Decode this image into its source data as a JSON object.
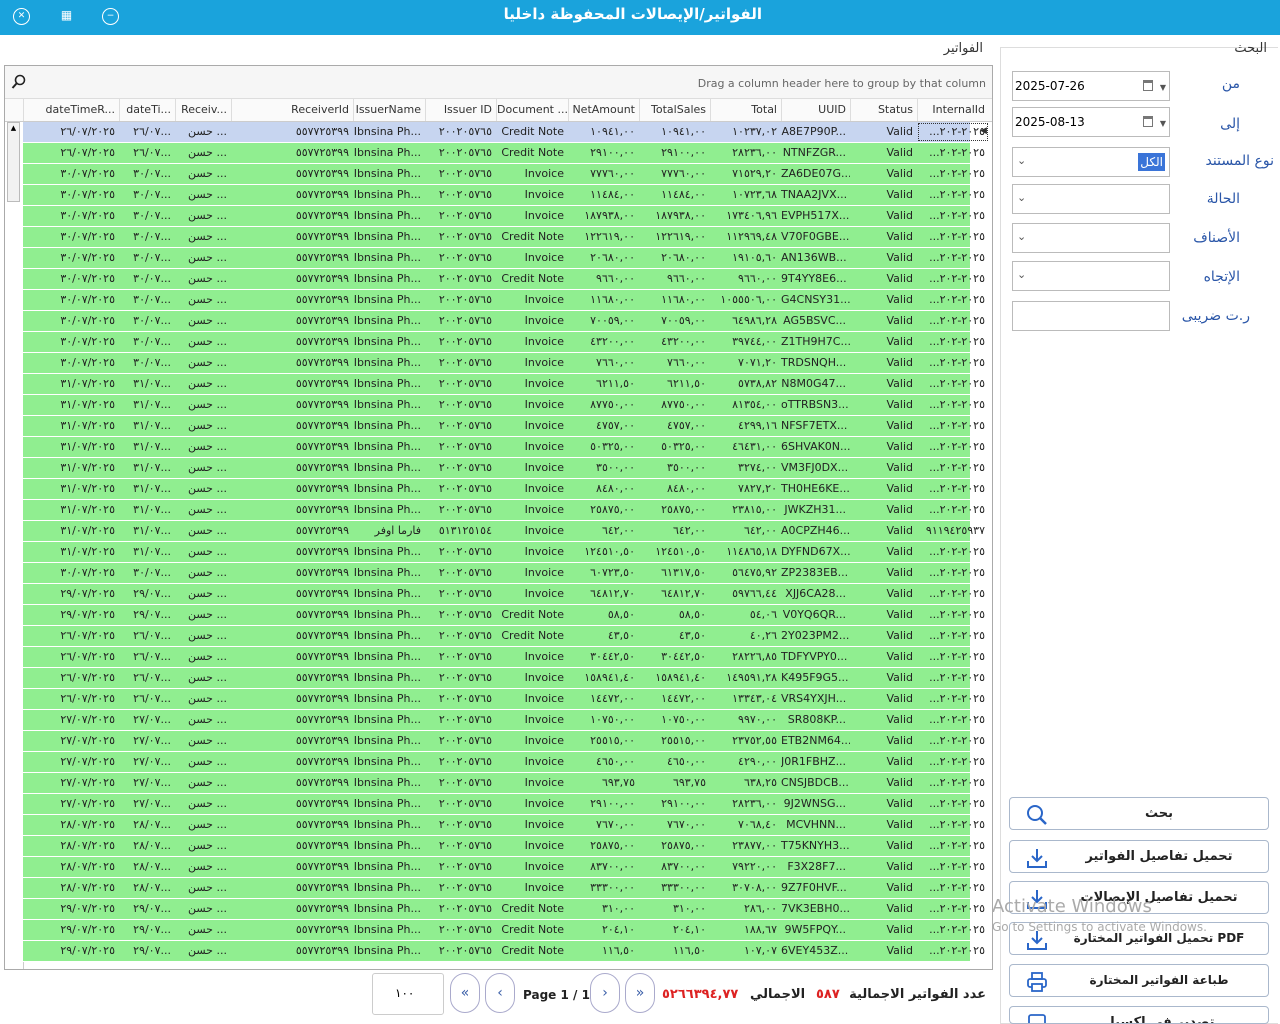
{
  "window": {
    "title": "الفواتير/الإيصالات المحفوظة داخليا",
    "buttons": [
      "close-icon",
      "maximize-icon",
      "minimize-icon"
    ]
  },
  "search": {
    "group_label": "البحث",
    "from_label": "من",
    "from_value": "2025-07-26",
    "to_label": "إلى",
    "to_value": "2025-08-13",
    "doctype_label": "نوع المستند",
    "doctype_value": "الكل",
    "status_label": "الحالة",
    "items_label": "الأصناف",
    "direction_label": "الإتجاه",
    "taxid_label": "ر.ت ضريبى"
  },
  "actions": {
    "search": "بحث",
    "load_invoices": "تحميل تفاصيل الفواتير",
    "load_receipts": "تحميل تفاصيل الإيصالات",
    "load_pdf": "تحميل الفواتير المختارة PDF",
    "print": "طباعة الفواتير المختارة",
    "export_excel": "تصدير في اكسيل"
  },
  "grid": {
    "title": "الفواتير",
    "group_hint": "Drag a column header here to group by that column",
    "columns": [
      "InternalId",
      "Status",
      "UUID",
      "Total",
      "TotalSales",
      "NetAmount",
      "Document ...",
      "Issuer ID",
      "IssuerName",
      "ReceiverId",
      "Receiv...",
      "dateTi...",
      "dateTimeR..."
    ],
    "rows": [
      [
        "...٢٠٢٥-٢٠٢",
        "Valid",
        "A8E7P90P...",
        "١٠٢٣٧,٠٢",
        "١٠٩٤١,٠٠",
        "١٠٩٤١,٠٠",
        "Credit Note",
        "٢٠٠٢٠٥٧٦٥",
        "Ibnsina Ph...",
        "٥٥٧٧٢٥٣٩٩",
        "حسن ...",
        "٢٦/٠٧...",
        "٢٦/٠٧/٢٠٢٥"
      ],
      [
        "...٢٠٢٥-٢٠٢",
        "Valid",
        "NTNFZGR...",
        "٢٨٢٣٦,٠٠",
        "٢٩١٠٠,٠٠",
        "٢٩١٠٠,٠٠",
        "Credit Note",
        "٢٠٠٢٠٥٧٦٥",
        "Ibnsina Ph...",
        "٥٥٧٧٢٥٣٩٩",
        "حسن ...",
        "٢٦/٠٧...",
        "٢٦/٠٧/٢٠٢٥"
      ],
      [
        "...٢٠٢٥-٢٠٢",
        "Valid",
        "ZA6DE07G...",
        "٧١٥٢٩,٢٠",
        "٧٧٧٦٠,٠٠",
        "٧٧٧٦٠,٠٠",
        "Invoice",
        "٢٠٠٢٠٥٧٦٥",
        "Ibnsina Ph...",
        "٥٥٧٧٢٥٣٩٩",
        "حسن ...",
        "٣٠/٠٧...",
        "٣٠/٠٧/٢٠٢٥"
      ],
      [
        "...٢٠٢٥-٢٠٢",
        "Valid",
        "TNAA2JVX...",
        "١٠٧٢٣,٦٨",
        "١١٤٨٤,٠٠",
        "١١٤٨٤,٠٠",
        "Invoice",
        "٢٠٠٢٠٥٧٦٥",
        "Ibnsina Ph...",
        "٥٥٧٧٢٥٣٩٩",
        "حسن ...",
        "٣٠/٠٧...",
        "٣٠/٠٧/٢٠٢٥"
      ],
      [
        "...٢٠٢٥-٢٠٢",
        "Valid",
        "EVPH517X...",
        "١٧٣٤٠٦,٩٦",
        "١٨٧٩٣٨,٠٠",
        "١٨٧٩٣٨,٠٠",
        "Invoice",
        "٢٠٠٢٠٥٧٦٥",
        "Ibnsina Ph...",
        "٥٥٧٧٢٥٣٩٩",
        "حسن ...",
        "٣٠/٠٧...",
        "٣٠/٠٧/٢٠٢٥"
      ],
      [
        "...٢٠٢٥-٢٠٢",
        "Valid",
        "V70F0GBE...",
        "١١٢٩٦٩,٤٨",
        "١٢٢٦١٩,٠٠",
        "١٢٢٦١٩,٠٠",
        "Credit Note",
        "٢٠٠٢٠٥٧٦٥",
        "Ibnsina Ph...",
        "٥٥٧٧٢٥٣٩٩",
        "حسن ...",
        "٣٠/٠٧...",
        "٣٠/٠٧/٢٠٢٥"
      ],
      [
        "...٢٠٢٥-٢٠٢",
        "Valid",
        "AN136WB...",
        "١٩١٠٥,٦٠",
        "٢٠٦٨٠,٠٠",
        "٢٠٦٨٠,٠٠",
        "Invoice",
        "٢٠٠٢٠٥٧٦٥",
        "Ibnsina Ph...",
        "٥٥٧٧٢٥٣٩٩",
        "حسن ...",
        "٣٠/٠٧...",
        "٣٠/٠٧/٢٠٢٥"
      ],
      [
        "...٢٠٢٥-٢٠٢",
        "Valid",
        "9T4YY8E6...",
        "٩٦٦٠,٠٠",
        "٩٦٦٠,٠٠",
        "٩٦٦٠,٠٠",
        "Credit Note",
        "٢٠٠٢٠٥٧٦٥",
        "Ibnsina Ph...",
        "٥٥٧٧٢٥٣٩٩",
        "حسن ...",
        "٣٠/٠٧...",
        "٣٠/٠٧/٢٠٢٥"
      ],
      [
        "...٢٠٢٥-٢٠٢",
        "Valid",
        "G4CNSY31...",
        "١٠٥٥٥٠٦,٠٠",
        "١١٦٨٠,٠٠",
        "١١٦٨٠,٠٠",
        "Invoice",
        "٢٠٠٢٠٥٧٦٥",
        "Ibnsina Ph...",
        "٥٥٧٧٢٥٣٩٩",
        "حسن ...",
        "٣٠/٠٧...",
        "٣٠/٠٧/٢٠٢٥"
      ],
      [
        "...٢٠٢٥-٢٠٢",
        "Valid",
        "AG5BSVC...",
        "٦٤٩٨٦,٢٨",
        "٧٠٠٥٩,٠٠",
        "٧٠٠٥٩,٠٠",
        "Invoice",
        "٢٠٠٢٠٥٧٦٥",
        "Ibnsina Ph...",
        "٥٥٧٧٢٥٣٩٩",
        "حسن ...",
        "٣٠/٠٧...",
        "٣٠/٠٧/٢٠٢٥"
      ],
      [
        "...٢٠٢٥-٢٠٢",
        "Valid",
        "Z1TH9H7C...",
        "٣٩٧٤٤,٠٠",
        "٤٣٢٠٠,٠٠",
        "٤٣٢٠٠,٠٠",
        "Invoice",
        "٢٠٠٢٠٥٧٦٥",
        "Ibnsina Ph...",
        "٥٥٧٧٢٥٣٩٩",
        "حسن ...",
        "٣٠/٠٧...",
        "٣٠/٠٧/٢٠٢٥"
      ],
      [
        "...٢٠٢٥-٢٠٢",
        "Valid",
        "TRDSNQH...",
        "٧٠٧١,٢٠",
        "٧٦٦٠,٠٠",
        "٧٦٦٠,٠٠",
        "Invoice",
        "٢٠٠٢٠٥٧٦٥",
        "Ibnsina Ph...",
        "٥٥٧٧٢٥٣٩٩",
        "حسن ...",
        "٣٠/٠٧...",
        "٣٠/٠٧/٢٠٢٥"
      ],
      [
        "...٢٠٢٥-٢٠٢",
        "Valid",
        "N8M0G47...",
        "٥٧٣٨,٨٢",
        "٦٢١١,٥٠",
        "٦٢١١,٥٠",
        "Invoice",
        "٢٠٠٢٠٥٧٦٥",
        "Ibnsina Ph...",
        "٥٥٧٧٢٥٣٩٩",
        "حسن ...",
        "٣١/٠٧...",
        "٣١/٠٧/٢٠٢٥"
      ],
      [
        "...٢٠٢٥-٢٠٢",
        "Valid",
        "oTTRBSN3...",
        "٨١٣٥٤,٠٠",
        "٨٧٧٥٠,٠٠",
        "٨٧٧٥٠,٠٠",
        "Invoice",
        "٢٠٠٢٠٥٧٦٥",
        "Ibnsina Ph...",
        "٥٥٧٧٢٥٣٩٩",
        "حسن ...",
        "٣١/٠٧...",
        "٣١/٠٧/٢٠٢٥"
      ],
      [
        "...٢٠٢٥-٢٠٢",
        "Valid",
        "NFSF7ETX...",
        "٤٢٩٩,١٦",
        "٤٧٥٧,٠٠",
        "٤٧٥٧,٠٠",
        "Invoice",
        "٢٠٠٢٠٥٧٦٥",
        "Ibnsina Ph...",
        "٥٥٧٧٢٥٣٩٩",
        "حسن ...",
        "٣١/٠٧...",
        "٣١/٠٧/٢٠٢٥"
      ],
      [
        "...٢٠٢٥-٢٠٢",
        "Valid",
        "6SHVAK0N...",
        "٤٦٤٣١,٠٠",
        "٥٠٣٢٥,٠٠",
        "٥٠٣٢٥,٠٠",
        "Invoice",
        "٢٠٠٢٠٥٧٦٥",
        "Ibnsina Ph...",
        "٥٥٧٧٢٥٣٩٩",
        "حسن ...",
        "٣١/٠٧...",
        "٣١/٠٧/٢٠٢٥"
      ],
      [
        "...٢٠٢٥-٢٠٢",
        "Valid",
        "VM3FJ0DX...",
        "٣٢٧٤,٠٠",
        "٣٥٠٠,٠٠",
        "٣٥٠٠,٠٠",
        "Invoice",
        "٢٠٠٢٠٥٧٦٥",
        "Ibnsina Ph...",
        "٥٥٧٧٢٥٣٩٩",
        "حسن ...",
        "٣١/٠٧...",
        "٣١/٠٧/٢٠٢٥"
      ],
      [
        "...٢٠٢٥-٢٠٢",
        "Valid",
        "TH0HE6KE...",
        "٧٨٢٧,٢٠",
        "٨٤٨٠,٠٠",
        "٨٤٨٠,٠٠",
        "Invoice",
        "٢٠٠٢٠٥٧٦٥",
        "Ibnsina Ph...",
        "٥٥٧٧٢٥٣٩٩",
        "حسن ...",
        "٣١/٠٧...",
        "٣١/٠٧/٢٠٢٥"
      ],
      [
        "...٢٠٢٥-٢٠٢",
        "Valid",
        "JWKZH31...",
        "٢٣٨١٥,٠٠",
        "٢٥٨٧٥,٠٠",
        "٢٥٨٧٥,٠٠",
        "Invoice",
        "٢٠٠٢٠٥٧٦٥",
        "Ibnsina Ph...",
        "٥٥٧٧٢٥٣٩٩",
        "حسن ...",
        "٣١/٠٧...",
        "٣١/٠٧/٢٠٢٥"
      ],
      [
        "٩١١٩٤٢٥٩٣٧",
        "Valid",
        "A0CPZH46...",
        "٦٤٢,٠٠",
        "٦٤٢,٠٠",
        "٦٤٢,٠٠",
        "Invoice",
        "٥١٣١٢٥١٥٤",
        "فارما اوفر",
        "٥٥٧٧٢٥٣٩٩",
        "حسن ...",
        "٣١/٠٧...",
        "٣١/٠٧/٢٠٢٥"
      ],
      [
        "...٢٠٢٥-٢٠٢",
        "Valid",
        "DYFND67X...",
        "١١٤٨٦٥,١٨",
        "١٢٤٥١٠,٥٠",
        "١٢٤٥١٠,٥٠",
        "Invoice",
        "٢٠٠٢٠٥٧٦٥",
        "Ibnsina Ph...",
        "٥٥٧٧٢٥٣٩٩",
        "حسن ...",
        "٣١/٠٧...",
        "٣١/٠٧/٢٠٢٥"
      ],
      [
        "...٢٠٢٥-٢٠٢",
        "Valid",
        "ZP2383EB...",
        "٥٦٤٧٥,٩٢",
        "٦١٣١٧,٥٠",
        "٦٠٧٢٣,٥٠",
        "Invoice",
        "٢٠٠٢٠٥٧٦٥",
        "Ibnsina Ph...",
        "٥٥٧٧٢٥٣٩٩",
        "حسن ...",
        "٣٠/٠٧...",
        "٣٠/٠٧/٢٠٢٥"
      ],
      [
        "...٢٠٢٥-٢٠٢",
        "Valid",
        "XJJ6CA28...",
        "٥٩٧٦٦,٤٤",
        "٦٤٨١٢,٧٠",
        "٦٤٨١٢,٧٠",
        "Invoice",
        "٢٠٠٢٠٥٧٦٥",
        "Ibnsina Ph...",
        "٥٥٧٧٢٥٣٩٩",
        "حسن ...",
        "٢٩/٠٧...",
        "٢٩/٠٧/٢٠٢٥"
      ],
      [
        "...٢٠٢٥-٢٠٢",
        "Valid",
        "V0YQ6QR...",
        "٥٤,٠٦",
        "٥٨,٥٠",
        "٥٨,٥٠",
        "Credit Note",
        "٢٠٠٢٠٥٧٦٥",
        "Ibnsina Ph...",
        "٥٥٧٧٢٥٣٩٩",
        "حسن ...",
        "٢٩/٠٧...",
        "٢٩/٠٧/٢٠٢٥"
      ],
      [
        "...٢٠٢٥-٢٠٢",
        "Valid",
        "2Y023PM2...",
        "٤٠,٢٦",
        "٤٣,٥٠",
        "٤٣,٥٠",
        "Credit Note",
        "٢٠٠٢٠٥٧٦٥",
        "Ibnsina Ph...",
        "٥٥٧٧٢٥٣٩٩",
        "حسن ...",
        "٢٦/٠٧...",
        "٢٦/٠٧/٢٠٢٥"
      ],
      [
        "...٢٠٢٥-٢٠٢",
        "Valid",
        "TDFYVPY0...",
        "٢٨٢٢٦,٨٥",
        "٣٠٤٤٢,٥٠",
        "٣٠٤٤٢,٥٠",
        "Invoice",
        "٢٠٠٢٠٥٧٦٥",
        "Ibnsina Ph...",
        "٥٥٧٧٢٥٣٩٩",
        "حسن ...",
        "٢٦/٠٧...",
        "٢٦/٠٧/٢٠٢٥"
      ],
      [
        "...٢٠٢٥-٢٠٢",
        "Valid",
        "K495F9G5...",
        "١٤٩٥٩١,٢٨",
        "١٥٨٩٤١,٤٠",
        "١٥٨٩٤١,٤٠",
        "Invoice",
        "٢٠٠٢٠٥٧٦٥",
        "Ibnsina Ph...",
        "٥٥٧٧٢٥٣٩٩",
        "حسن ...",
        "٢٦/٠٧...",
        "٢٦/٠٧/٢٠٢٥"
      ],
      [
        "...٢٠٢٥-٢٠٢",
        "Valid",
        "VRS4YXJH...",
        "١٣٣٤٣,٠٤",
        "١٤٤٧٢,٠٠",
        "١٤٤٧٢,٠٠",
        "Invoice",
        "٢٠٠٢٠٥٧٦٥",
        "Ibnsina Ph...",
        "٥٥٧٧٢٥٣٩٩",
        "حسن ...",
        "٢٦/٠٧...",
        "٢٦/٠٧/٢٠٢٥"
      ],
      [
        "...٢٠٢٥-٢٠٢",
        "Valid",
        "SR808KP...",
        "٩٩٧٠,٠٠",
        "١٠٧٥٠,٠٠",
        "١٠٧٥٠,٠٠",
        "Invoice",
        "٢٠٠٢٠٥٧٦٥",
        "Ibnsina Ph...",
        "٥٥٧٧٢٥٣٩٩",
        "حسن ...",
        "٢٧/٠٧...",
        "٢٧/٠٧/٢٠٢٥"
      ],
      [
        "...٢٠٢٥-٢٠٢",
        "Valid",
        "ETB2NM64...",
        "٢٣٧٥٢,٥٥",
        "٢٥٥١٥,٠٠",
        "٢٥٥١٥,٠٠",
        "Invoice",
        "٢٠٠٢٠٥٧٦٥",
        "Ibnsina Ph...",
        "٥٥٧٧٢٥٣٩٩",
        "حسن ...",
        "٢٧/٠٧...",
        "٢٧/٠٧/٢٠٢٥"
      ],
      [
        "...٢٠٢٥-٢٠٢",
        "Valid",
        "J0R1FBHZ...",
        "٤٢٩٠,٠٠",
        "٤٦٥٠,٠٠",
        "٤٦٥٠,٠٠",
        "Invoice",
        "٢٠٠٢٠٥٧٦٥",
        "Ibnsina Ph...",
        "٥٥٧٧٢٥٣٩٩",
        "حسن ...",
        "٢٧/٠٧...",
        "٢٧/٠٧/٢٠٢٥"
      ],
      [
        "...٢٠٢٥-٢٠٢",
        "Valid",
        "CNSJBDCB...",
        "٦٣٨,٢٥",
        "٦٩٣,٧٥",
        "٦٩٣,٧٥",
        "Invoice",
        "٢٠٠٢٠٥٧٦٥",
        "Ibnsina Ph...",
        "٥٥٧٧٢٥٣٩٩",
        "حسن ...",
        "٢٧/٠٧...",
        "٢٧/٠٧/٢٠٢٥"
      ],
      [
        "...٢٠٢٥-٢٠٢",
        "Valid",
        "9J2WNSG...",
        "٢٨٢٣٦,٠٠",
        "٢٩١٠٠,٠٠",
        "٢٩١٠٠,٠٠",
        "Invoice",
        "٢٠٠٢٠٥٧٦٥",
        "Ibnsina Ph...",
        "٥٥٧٧٢٥٣٩٩",
        "حسن ...",
        "٢٧/٠٧...",
        "٢٧/٠٧/٢٠٢٥"
      ],
      [
        "...٢٠٢٥-٢٠٢",
        "Valid",
        "MCVHNN...",
        "٧٠٦٨,٤٠",
        "٧٦٧٠,٠٠",
        "٧٦٧٠,٠٠",
        "Invoice",
        "٢٠٠٢٠٥٧٦٥",
        "Ibnsina Ph...",
        "٥٥٧٧٢٥٣٩٩",
        "حسن ...",
        "٢٨/٠٧...",
        "٢٨/٠٧/٢٠٢٥"
      ],
      [
        "...٢٠٢٥-٢٠٢",
        "Valid",
        "T75KNYH3...",
        "٢٣٨٧٧,٠٠",
        "٢٥٨٧٥,٠٠",
        "٢٥٨٧٥,٠٠",
        "Invoice",
        "٢٠٠٢٠٥٧٦٥",
        "Ibnsina Ph...",
        "٥٥٧٧٢٥٣٩٩",
        "حسن ...",
        "٢٨/٠٧...",
        "٢٨/٠٧/٢٠٢٥"
      ],
      [
        "...٢٠٢٥-٢٠٢",
        "Valid",
        "F3X28F7...",
        "٧٩٢٢٠,٠٠",
        "٨٣٧٠٠,٠٠",
        "٨٣٧٠٠,٠٠",
        "Invoice",
        "٢٠٠٢٠٥٧٦٥",
        "Ibnsina Ph...",
        "٥٥٧٧٢٥٣٩٩",
        "حسن ...",
        "٢٨/٠٧...",
        "٢٨/٠٧/٢٠٢٥"
      ],
      [
        "...٢٠٢٥-٢٠٢",
        "Valid",
        "9Z7F0HVF...",
        "٣٠٧٠٨,٠٠",
        "٣٣٣٠٠,٠٠",
        "٣٣٣٠٠,٠٠",
        "Invoice",
        "٢٠٠٢٠٥٧٦٥",
        "Ibnsina Ph...",
        "٥٥٧٧٢٥٣٩٩",
        "حسن ...",
        "٢٨/٠٧...",
        "٢٨/٠٧/٢٠٢٥"
      ],
      [
        "...٢٠٢٥-٢٠٢",
        "Valid",
        "7VK3EBH0...",
        "٢٨٦,٠٠",
        "٣١٠,٠٠",
        "٣١٠,٠٠",
        "Credit Note",
        "٢٠٠٢٠٥٧٦٥",
        "Ibnsina Ph...",
        "٥٥٧٧٢٥٣٩٩",
        "حسن ...",
        "٢٩/٠٧...",
        "٢٩/٠٧/٢٠٢٥"
      ],
      [
        "...٢٠٢٥-٢٠٢",
        "Valid",
        "9W5FPQY...",
        "١٨٨,٦٧",
        "٢٠٤,١٠",
        "٢٠٤,١٠",
        "Credit Note",
        "٢٠٠٢٠٥٧٦٥",
        "Ibnsina Ph...",
        "٥٥٧٧٢٥٣٩٩",
        "حسن ...",
        "٢٩/٠٧...",
        "٢٩/٠٧/٢٠٢٥"
      ],
      [
        "...٢٠٢٥-٢٠٢",
        "Valid",
        "6VEY453Z...",
        "١٠٧,٠٧",
        "١١٦,٥٠",
        "١١٦,٥٠",
        "Credit Note",
        "٢٠٠٢٠٥٧٦٥",
        "Ibnsina Ph...",
        "٥٥٧٧٢٥٣٩٩",
        "حسن ...",
        "٢٩/٠٧...",
        "٢٩/٠٧/٢٠٢٥"
      ]
    ]
  },
  "footer": {
    "total_count_label": "عدد الفواتير الاجمالية",
    "total_count": "٥٨٧",
    "total_label": "الاجمالي",
    "total_value": "٥٢٦٦٣٩٤,٧٧",
    "page_text": "Page 1 / 1",
    "page_size": "١٠٠"
  },
  "watermark": {
    "line1": "Activate Windows",
    "line2": "Go to Settings to activate Windows."
  }
}
